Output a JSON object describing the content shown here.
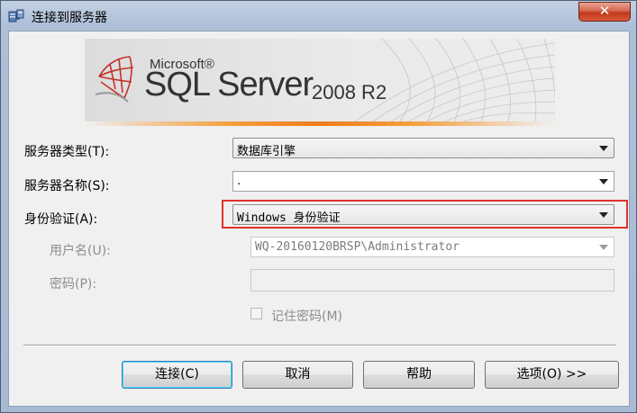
{
  "window": {
    "title": "连接到服务器",
    "close_glyph": "✕"
  },
  "banner": {
    "brand_small": "Microsoft®",
    "brand_main": "SQL Server",
    "version": "2008 R2",
    "logo_icon": "sql-server-logo"
  },
  "form": {
    "server_type": {
      "label": "服务器类型(T):",
      "value": "数据库引擎"
    },
    "server_name": {
      "label": "服务器名称(S):",
      "value": "."
    },
    "auth": {
      "label": "身份验证(A):",
      "value": "Windows 身份验证"
    },
    "username": {
      "label": "用户名(U):",
      "value": "WQ-20160120BRSP\\Administrator"
    },
    "password": {
      "label": "密码(P):",
      "value": ""
    },
    "remember": {
      "label": "记住密码(M)",
      "checked": false
    }
  },
  "buttons": {
    "connect": "连接(C)",
    "cancel": "取消",
    "help": "帮助",
    "options": "选项(O) >>"
  },
  "colors": {
    "highlight": "#e0322d",
    "banner_orange": "#f07d1e"
  }
}
